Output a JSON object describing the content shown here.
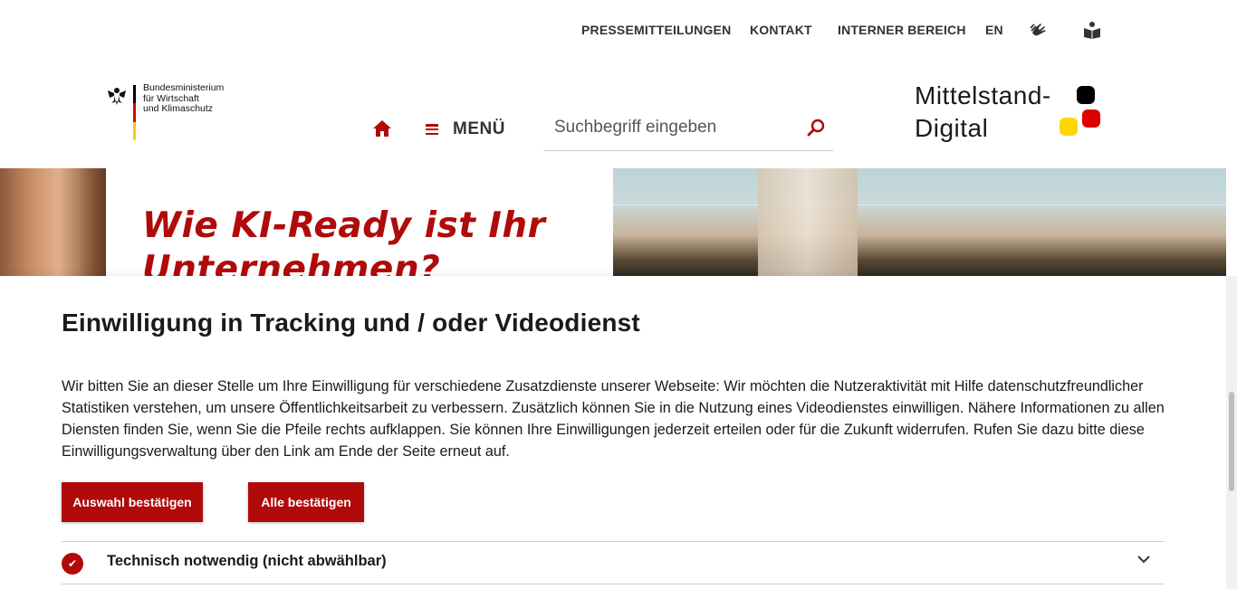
{
  "topnav": {
    "press": "PRESSEMITTEILUNGEN",
    "contact": "KONTAKT",
    "internal": "INTERNER BEREICH",
    "lang": "EN",
    "sign_language_icon": "sign-language-icon",
    "easy_language_icon": "easy-language-icon"
  },
  "header": {
    "ministry_line1": "Bundesministerium",
    "ministry_line2": "für Wirtschaft",
    "ministry_line3": "und Klimaschutz",
    "home_icon": "home-icon",
    "menu_label": "MENÜ",
    "search_placeholder": "Suchbegriff eingeben",
    "search_icon": "search-icon",
    "logo_line1": "Mittelstand-",
    "logo_line2": "Digital"
  },
  "hero": {
    "title": "Wie KI-Ready ist Ihr Unternehmen?"
  },
  "consent": {
    "heading": "Einwilligung in Tracking und / oder Videodienst",
    "body": "Wir bitten Sie an dieser Stelle um Ihre Einwilligung für verschiedene Zusatzdienste unserer Webseite: Wir möchten die Nutzeraktivität mit Hilfe datenschutzfreundlicher Statistiken verstehen, um unsere Öffentlichkeitsarbeit zu verbessern. Zusätzlich können Sie in die Nutzung eines Videodienstes einwilligen. Nähere Informationen zu allen Diensten finden Sie, wenn Sie die Pfeile rechts aufklappen. Sie können Ihre Einwilligungen jederzeit erteilen oder für die Zukunft widerrufen. Rufen Sie dazu bitte diese Einwilligungsverwaltung über den Link am Ende der Seite erneut auf.",
    "btn_select": "Auswahl bestätigen",
    "btn_all": "Alle bestätigen",
    "rows": [
      {
        "label": "Technisch notwendig (nicht abwählbar)",
        "checked": true
      }
    ]
  },
  "colors": {
    "brand_red": "#b00a0a",
    "flag_black": "#000000",
    "flag_red": "#dd0000",
    "flag_gold": "#ffce00"
  }
}
